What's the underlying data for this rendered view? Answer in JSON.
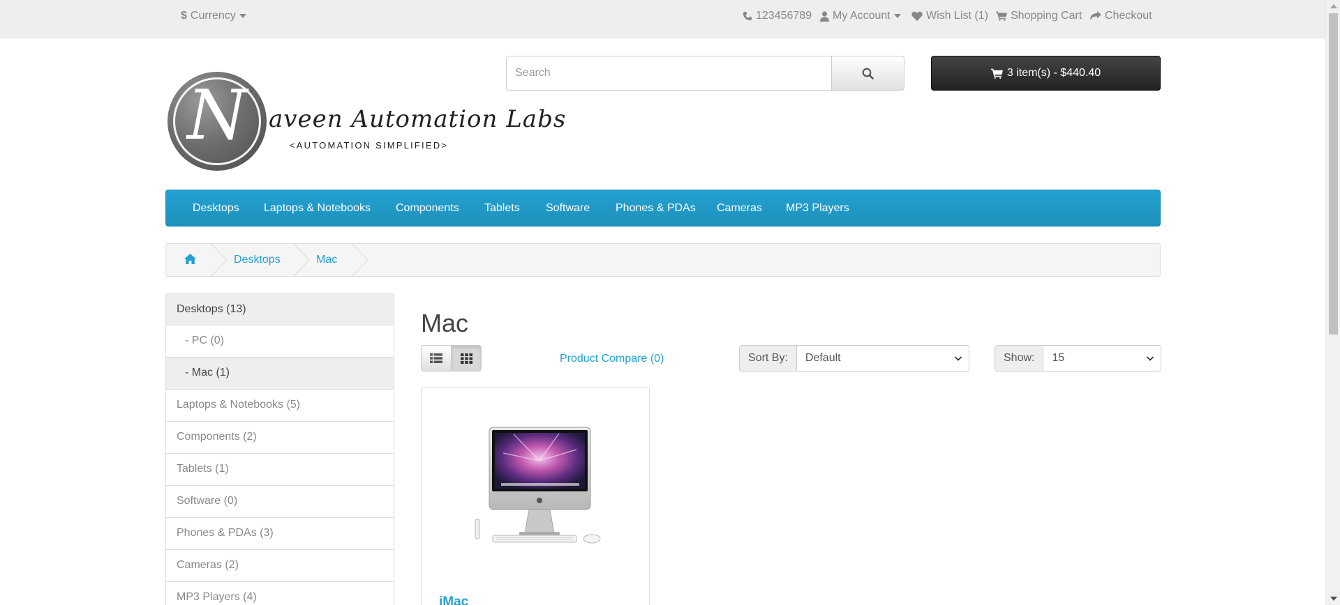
{
  "top_bar": {
    "currency_symbol": "$",
    "currency_label": "Currency",
    "phone": "123456789",
    "my_account": "My Account",
    "wish_list": "Wish List (1)",
    "shopping_cart": "Shopping Cart",
    "checkout": "Checkout"
  },
  "logo": {
    "initial": "N",
    "name": "aveen Automation Labs",
    "tagline": "<AUTOMATION SIMPLIFIED>"
  },
  "search": {
    "placeholder": "Search"
  },
  "cart": {
    "label": "3 item(s) - $440.40"
  },
  "menu": {
    "items": [
      "Desktops",
      "Laptops & Notebooks",
      "Components",
      "Tablets",
      "Software",
      "Phones & PDAs",
      "Cameras",
      "MP3 Players"
    ]
  },
  "breadcrumb": {
    "items": [
      "Desktops",
      "Mac"
    ]
  },
  "sidebar": {
    "items": [
      {
        "label": "Desktops (13)"
      },
      {
        "label": "- PC (0)"
      },
      {
        "label": "- Mac (1)"
      },
      {
        "label": "Laptops & Notebooks (5)"
      },
      {
        "label": "Components (2)"
      },
      {
        "label": "Tablets (1)"
      },
      {
        "label": "Software (0)"
      },
      {
        "label": "Phones & PDAs (3)"
      },
      {
        "label": "Cameras (2)"
      },
      {
        "label": "MP3 Players (4)"
      }
    ]
  },
  "main": {
    "title": "Mac",
    "compare_link": "Product Compare (0)",
    "sort_label": "Sort By:",
    "sort_value": "Default",
    "show_label": "Show:",
    "show_value": "15"
  },
  "products": [
    {
      "name": "iMac"
    }
  ],
  "colors": {
    "accent": "#23a1d1",
    "top_bar": "#eeeeee",
    "cart_button": "#333333"
  }
}
